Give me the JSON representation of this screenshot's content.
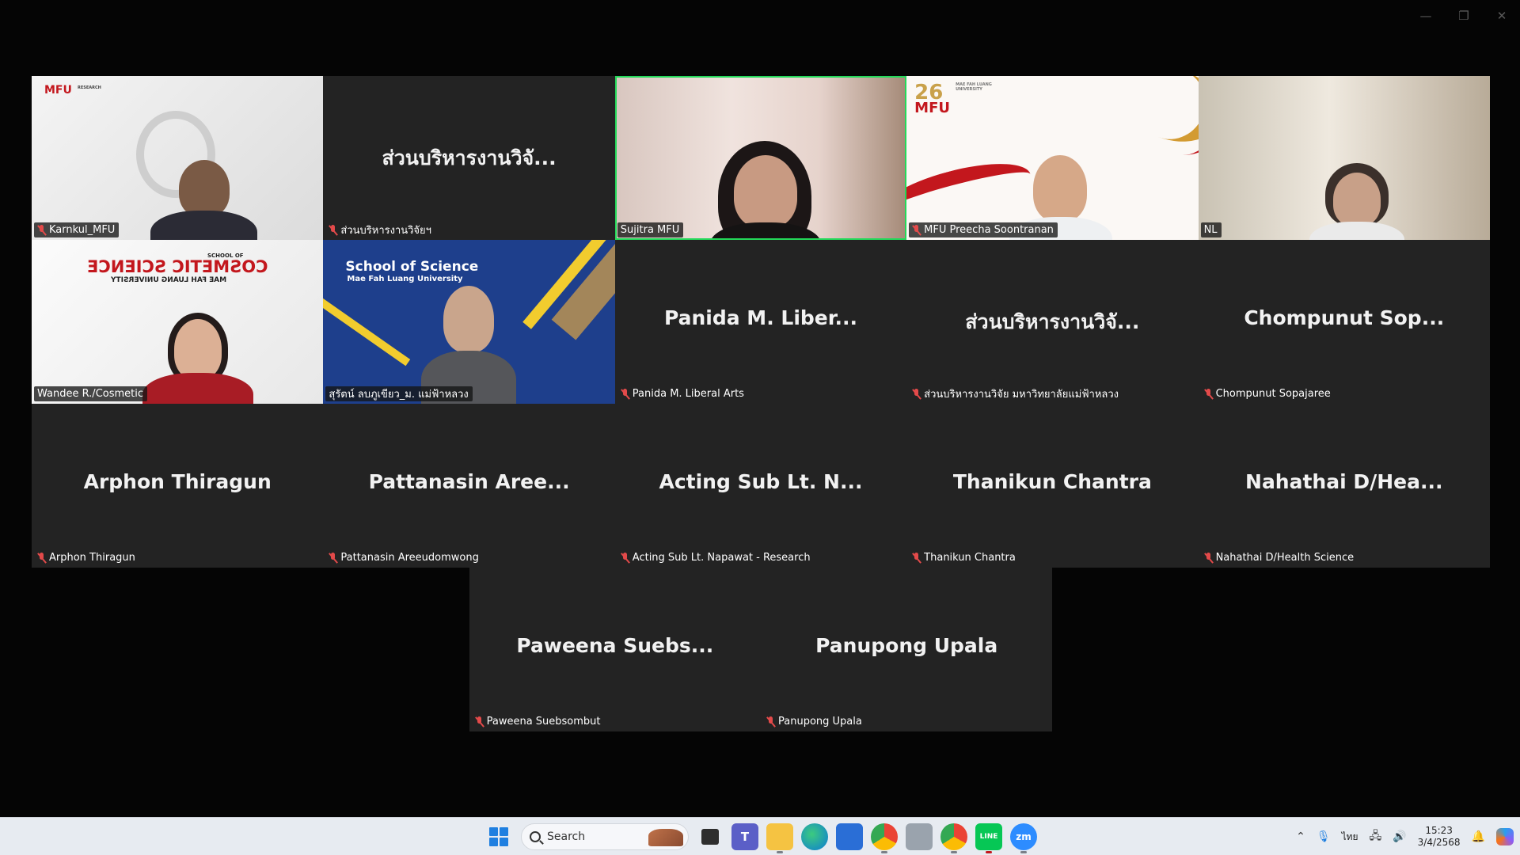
{
  "window": {
    "controls": [
      "—",
      "❐",
      "✕"
    ]
  },
  "tiles": [
    {
      "big": "",
      "tag": "Karnkul_MFU",
      "muted": true,
      "video": "karnkul"
    },
    {
      "big": "ส่วนบริหารงานวิจั...",
      "tag": "ส่วนบริหารงานวิจัยฯ",
      "muted": true,
      "video": ""
    },
    {
      "big": "",
      "tag": "Sujitra MFU",
      "muted": false,
      "video": "sujitra",
      "active": true
    },
    {
      "big": "",
      "tag": "MFU Preecha Soontranan",
      "muted": true,
      "video": "preecha"
    },
    {
      "big": "",
      "tag": "NL",
      "muted": false,
      "video": "nl"
    },
    {
      "big": "",
      "tag": "Wandee R./Cosmetic",
      "muted": false,
      "video": "wandee"
    },
    {
      "big": "",
      "tag": "สุรัตน์ ลบภูเขียว_ม. แม่ฟ้าหลวง",
      "muted": false,
      "video": "surat"
    },
    {
      "big": "Panida  M.  Liber...",
      "tag": "Panida M. Liberal Arts",
      "muted": true,
      "video": ""
    },
    {
      "big": "ส่วนบริหารงานวิจั...",
      "tag": "ส่วนบริหารงานวิจัย มหาวิทยาลัยแม่ฟ้าหลวง",
      "muted": true,
      "video": ""
    },
    {
      "big": "Chompunut  Sop...",
      "tag": "Chompunut Sopajaree",
      "muted": true,
      "video": ""
    },
    {
      "big": "Arphon Thiragun",
      "tag": "Arphon Thiragun",
      "muted": true,
      "video": ""
    },
    {
      "big": "Pattanasin  Aree...",
      "tag": "Pattanasin Areeudomwong",
      "muted": true,
      "video": ""
    },
    {
      "big": "Acting Sub Lt. N...",
      "tag": "Acting Sub Lt. Napawat - Research",
      "muted": true,
      "video": ""
    },
    {
      "big": "Thanikun Chantra",
      "tag": "Thanikun Chantra",
      "muted": true,
      "video": ""
    },
    {
      "big": "Nahathai  D/Hea...",
      "tag": "Nahathai D/Health Science",
      "muted": true,
      "video": ""
    },
    {
      "big": "Paweena  Suebs...",
      "tag": "Paweena Suebsombut",
      "muted": true,
      "video": ""
    },
    {
      "big": "Panupong Upala",
      "tag": "Panupong Upala",
      "muted": true,
      "video": ""
    }
  ],
  "backgrounds": {
    "karnkul_logo": "MFU",
    "karnkul_logo_small": "RESEARCH",
    "preecha_logo": "26",
    "preecha_logo2": "MFU",
    "preecha_logo3": "MAE FAH LUANG UNIVERSITY",
    "wandee_line1": "SCHOOL OF",
    "wandee_line2": "COSMETIC SCIENCE",
    "wandee_line3": "MAE FAH LUANG UNIVERSITY",
    "surat_line1": "School of Science",
    "surat_line2": "Mae Fah Luang University"
  },
  "taskbar": {
    "search_placeholder": "Search",
    "apps": [
      "task-view",
      "teams",
      "file-explorer",
      "edge",
      "store",
      "chrome",
      "photos",
      "chrome-profile",
      "line",
      "zoom"
    ],
    "line_label": "LINE",
    "zoom_label": "zm",
    "lang": "ไทย",
    "time": "15:23",
    "date": "3/4/2568",
    "colors": {
      "accent": "#1f7fe0",
      "active_border": "#23d959",
      "mute": "#e34a4a"
    }
  }
}
